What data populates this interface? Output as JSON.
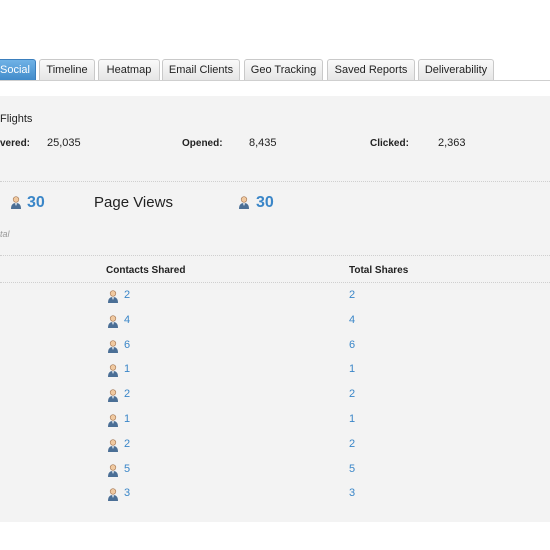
{
  "tabs": [
    {
      "label": "Social",
      "active": true
    },
    {
      "label": "Timeline",
      "active": false
    },
    {
      "label": "Heatmap",
      "active": false
    },
    {
      "label": "Email Clients",
      "active": false
    },
    {
      "label": "Geo Tracking",
      "active": false
    },
    {
      "label": "Saved Reports",
      "active": false
    },
    {
      "label": "Deliverability",
      "active": false
    }
  ],
  "summary": {
    "title": "Flights",
    "delivered_label": "vered:",
    "delivered_value": "25,035",
    "opened_label": "Opened:",
    "opened_value": "8,435",
    "clicked_label": "Clicked:",
    "clicked_value": "2,363"
  },
  "stats": {
    "first_value": "30",
    "page_views_label": "Page Views",
    "page_views_value": "30",
    "note": "tal"
  },
  "table": {
    "headers": [
      "Contacts Shared",
      "Total Shares"
    ],
    "rows": [
      {
        "contacts": "2",
        "total": "2"
      },
      {
        "contacts": "4",
        "total": "4"
      },
      {
        "contacts": "6",
        "total": "6"
      },
      {
        "contacts": "1",
        "total": "1"
      },
      {
        "contacts": "2",
        "total": "2"
      },
      {
        "contacts": "1",
        "total": "1"
      },
      {
        "contacts": "2",
        "total": "2"
      },
      {
        "contacts": "5",
        "total": "5"
      },
      {
        "contacts": "3",
        "total": "3"
      }
    ]
  },
  "colors": {
    "accent": "#3a86c8",
    "active_tab": "#4a94d4",
    "panel_bg": "#f3f3f3"
  },
  "icons": {
    "person": "person-icon"
  }
}
